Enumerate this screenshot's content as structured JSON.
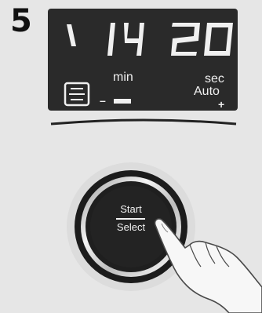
{
  "step": {
    "number": "5"
  },
  "display": {
    "time_digits": "' 14 20",
    "min_label": "min",
    "sec_label": "sec",
    "auto_label": "Auto",
    "plus_label": "+",
    "minus_label": "–"
  },
  "knob": {
    "start_label": "Start",
    "select_label": "Select"
  },
  "icons": {
    "oven": "oven-icon",
    "hand": "pointing-hand-icon"
  },
  "colors": {
    "background": "#e6e6e6",
    "display": "#2a2a2a",
    "segment": "#f0f0f0"
  }
}
